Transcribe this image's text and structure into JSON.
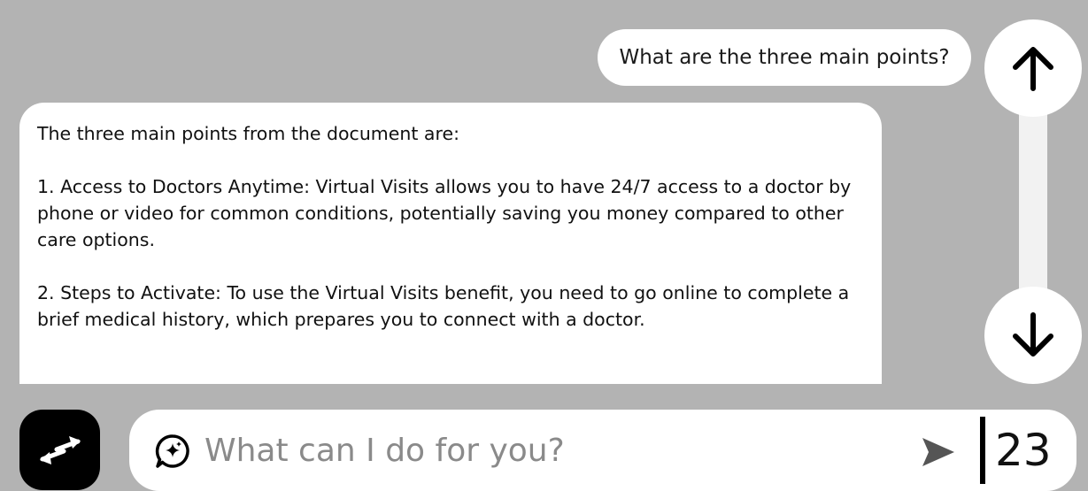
{
  "user_message": {
    "text": "What are the three main points?"
  },
  "assistant_message": {
    "intro": "The three main points from the document are:",
    "point_1": "1. Access to Doctors Anytime: Virtual Visits allows you to have 24/7 access to a doctor by phone or video for common conditions, potentially saving you money compared to other care options.",
    "point_2": "2. Steps to Activate: To use the Virtual Visits benefit, you need to go online to complete a brief medical history, which prepares you to connect with a doctor."
  },
  "scroll": {
    "up_icon": "arrow-up-icon",
    "down_icon": "arrow-down-icon"
  },
  "swap_button": {
    "icon": "swap-arrows-icon"
  },
  "input_bar": {
    "placeholder": "What can I do for you?",
    "value": "",
    "icon": "chat-sparkle-icon",
    "send_icon": "send-icon",
    "counter": "23"
  },
  "colors": {
    "background": "#b3b3b3",
    "bubble": "#ffffff",
    "swap_button": "#000000",
    "send_icon": "#555555"
  }
}
